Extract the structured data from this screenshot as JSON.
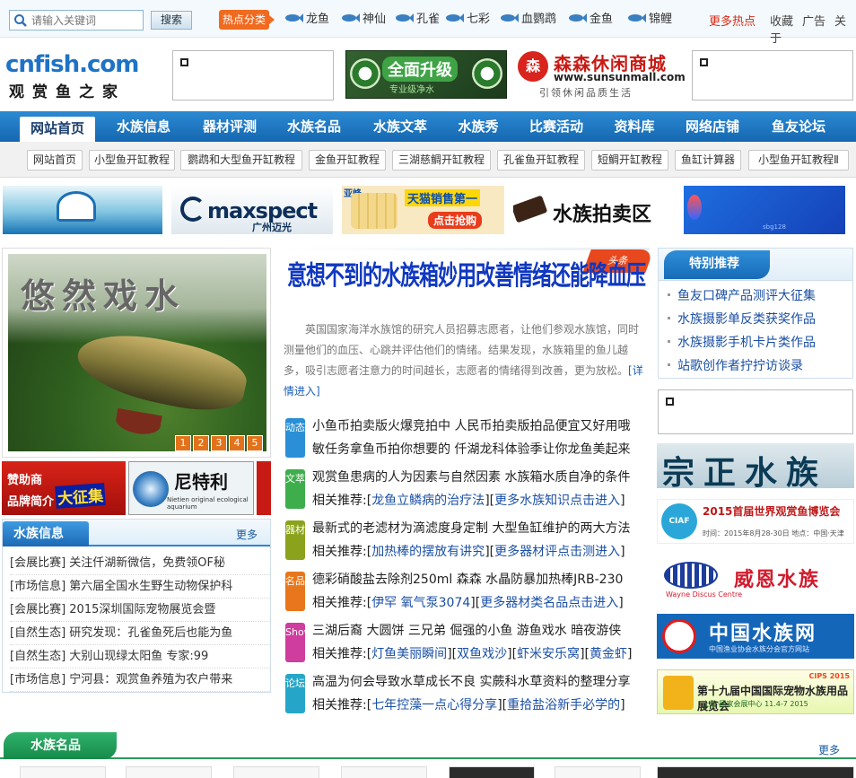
{
  "topbar": {
    "search_placeholder": "请输入关键词",
    "search_button": "搜索",
    "hot_label": "热点分类",
    "fish_links": [
      "龙鱼",
      "神仙",
      "孔雀",
      "七彩",
      "血鹦鹉",
      "金鱼",
      "锦鲤"
    ],
    "more_hot": "更多热点",
    "right_links": [
      "收藏",
      "广告",
      "关于"
    ]
  },
  "header": {
    "logo_main": "cnfish.com",
    "logo_sub": "观赏鱼之家",
    "ad_upgrade_title": "全面升级",
    "ad_upgrade_sub": "专业级净水",
    "ad_sunsun_badge": "森",
    "ad_sunsun_name": "森森休闲商城",
    "ad_sunsun_url": "www.sunsunmall.com",
    "ad_sunsun_slogan": "引领休闲品质生活"
  },
  "nav": {
    "items": [
      "网站首页",
      "水族信息",
      "器材评测",
      "水族名品",
      "水族文萃",
      "水族秀",
      "比赛活动",
      "资料库",
      "网络店铺",
      "鱼友论坛"
    ]
  },
  "subnav": {
    "items": [
      "网站首页",
      "小型鱼开缸教程",
      "鹦鹉和大型鱼开缸教程",
      "金鱼开缸教程",
      "三湖慈鲷开缸教程",
      "孔雀鱼开缸教程",
      "短鲷开缸教程",
      "鱼缸计算器",
      "小型鱼开缸教程Ⅱ"
    ]
  },
  "banners": {
    "b2_brand": "maxspect",
    "b2_city": "广州迈光",
    "b3_corner": "亚峰",
    "b3_headline": "天猫销售第一",
    "b3_button": "点击抢购",
    "b4_title": "水族拍卖区",
    "b5_small": "sbg128"
  },
  "slideshow": {
    "caption": "悠然戏水",
    "pages": [
      "1",
      "2",
      "3",
      "4",
      "5"
    ]
  },
  "sponsors": {
    "sp1_line1": "赞助商",
    "sp1_line2": "品牌简介",
    "sp1_badge": "大征集",
    "sp2_name": "尼特利",
    "sp2_sub": "Nietien original ecological aquarium"
  },
  "news_box": {
    "title": "水族信息",
    "more": "更多",
    "rows": [
      "[会展比赛] 关注仟湖新微信，免费领OF秘",
      "[市场信息] 第六届全国水生野生动物保护科",
      "[会展比赛] 2015深圳国际宠物展览会暨",
      "[自然生态] 研究发现：孔雀鱼死后也能为鱼",
      "[自然生态] 大别山现绿太阳鱼  专家:99",
      "[市场信息] 宁河县：观赏鱼养殖为农户带来"
    ]
  },
  "headline": {
    "tag": "头条",
    "title": "意想不到的水族箱妙用改善情绪还能降血压",
    "summary": "英国国家海洋水族馆的研究人员招募志愿者，让他们参观水族馆，同时测量他们的血压、心跳并评估他们的情绪。结果发现，水族箱里的鱼儿越多，吸引志愿者注意力的时间越长，志愿者的情绪得到改善，更为放松。",
    "more": "[详情进入]"
  },
  "categories": [
    {
      "badge": "动态",
      "color": "#2a8fd6",
      "line1": "小鱼币拍卖版火爆竞拍中  人民币拍卖版拍品便宜又好用哦",
      "line2": "敏任务拿鱼币拍你想要的  仟湖龙科体验季让你龙鱼美起来"
    },
    {
      "badge": "文萃",
      "color": "#3eae4c",
      "line1": "观赏鱼患病的人为因素与自然因素  水族箱水质自净的条件",
      "line2_prefix": "相关推荐:[",
      "line2_links": [
        "龙鱼立鳞病的治疗法",
        "更多水族知识点击进入"
      ]
    },
    {
      "badge": "器材",
      "color": "#8aa21c",
      "line1": "最新式的老滤材为滴滤度身定制  大型鱼缸维护的两大方法",
      "line2_prefix": "相关推荐:[",
      "line2_links": [
        "加热棒的摆放有讲究",
        "更多器材评点击测进入"
      ]
    },
    {
      "badge": "名品",
      "color": "#e7761c",
      "line1": "德彩硝酸盐去除剂250ml 森森  水晶防暴加热棒JRB-230",
      "line2_prefix": "相关推荐:[",
      "line2_links": [
        "伊罕  氧气泵3074",
        "更多器材类名品点击进入"
      ]
    },
    {
      "badge": "Show",
      "color": "#cf3d9e",
      "line1": "三湖后裔  大圆饼  三兄弟  倔强的小鱼  游鱼戏水  暗夜游侠",
      "line2_prefix": "相关推荐:[",
      "line2_links": [
        "灯鱼美丽瞬间",
        "双鱼戏沙",
        "虾米安乐窝",
        "黄金虾"
      ]
    },
    {
      "badge": "论坛",
      "color": "#25a6c8",
      "line1": "高温为何会导致水草成长不良  实蕨科水草资料的整理分享",
      "line2_prefix": "相关推荐:[",
      "line2_links": [
        "七年控藻一点心得分享",
        "重拾盐浴新手必学的"
      ]
    }
  ],
  "right_box": {
    "title": "特别推荐",
    "items": [
      "鱼友口碑产品测评大征集",
      "水族摄影单反类获奖作品",
      "水族摄影手机卡片类作品",
      "站歌创作者拧拧访谈录"
    ]
  },
  "right_ads": {
    "ad1": "宗正水族",
    "ad2_badge": "CIAF",
    "ad2_title": "2015首届世界观赏鱼博览会",
    "ad2_sub": "时间：2015年8月28-30日  地点：中国·天津",
    "ad3_title": "威恩水族",
    "ad3_sub": "Wayne Discus Centre",
    "ad4_title": "中国水族网",
    "ad4_sub": "中国渔业协会水族分会官方网站",
    "ad5_title": "第十九届中国国际宠物水族用品展览会",
    "ad5_sub": "上海·国家会展中心  11.4-7  2015",
    "ad5_year": "CIPS 2015"
  },
  "bottom": {
    "title": "水族名品",
    "more": "更多"
  }
}
